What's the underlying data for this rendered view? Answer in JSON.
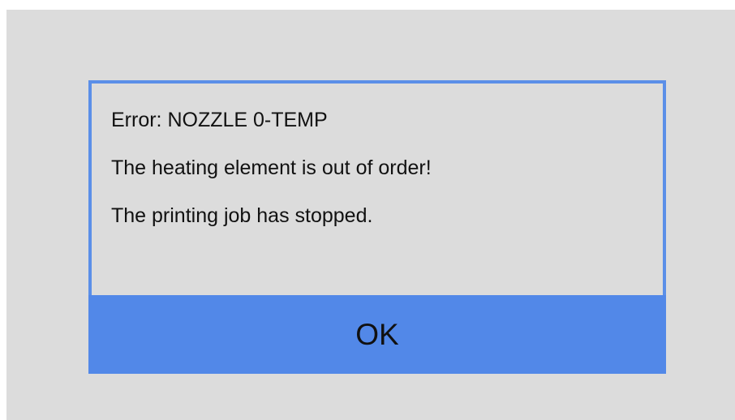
{
  "dialog": {
    "lines": [
      "Error: NOZZLE 0-TEMP",
      "The heating element is out of order!",
      "The printing job has stopped."
    ],
    "ok_label": "OK"
  },
  "colors": {
    "background": "#dcdcdc",
    "dialog_border": "#5b8fe8",
    "button": "#5288e8",
    "text": "#111111"
  }
}
